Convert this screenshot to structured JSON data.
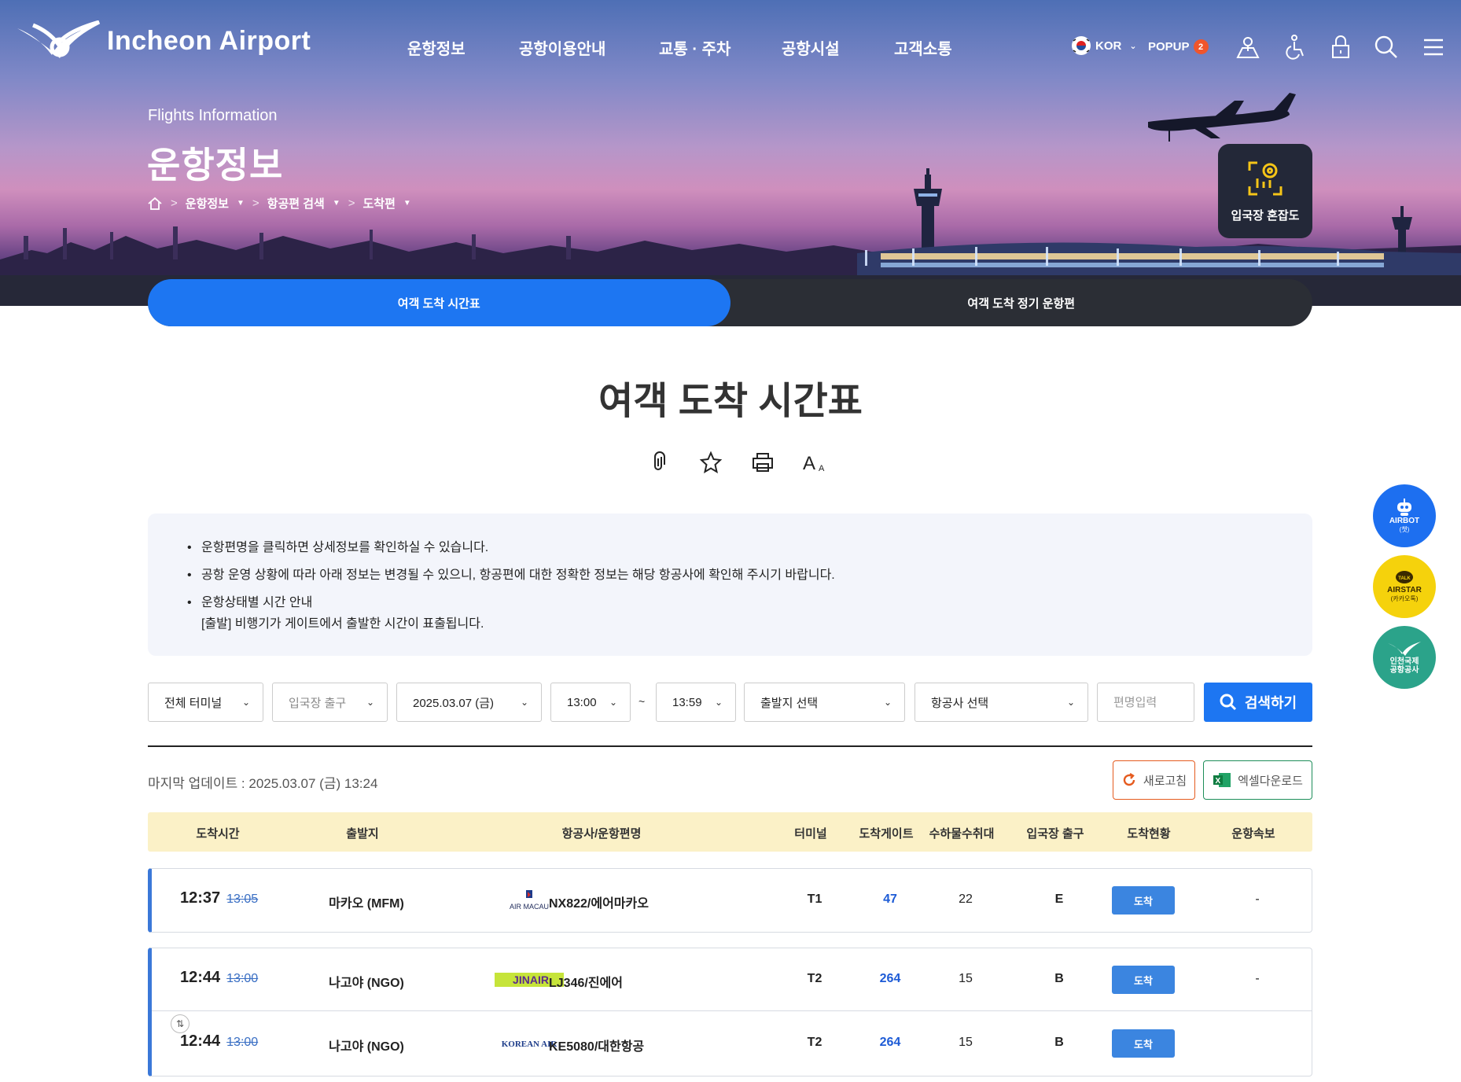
{
  "header": {
    "logo_text": "Incheon Airport",
    "menu": [
      "운항정보",
      "공항이용안내",
      "교통 · 주차",
      "공항시설",
      "고객소통"
    ],
    "lang": "KOR",
    "popup_label": "POPUP",
    "popup_count": "2",
    "icons": [
      "map-pin-icon",
      "wheelchair-icon",
      "lock-icon",
      "search-icon",
      "hamburger-menu-icon"
    ]
  },
  "hero": {
    "subtitle": "Flights Information",
    "title": "운항정보",
    "breadcrumb": [
      "운항정보",
      "항공편 검색",
      "도착편"
    ],
    "congestion_label": "입국장 혼잡도"
  },
  "tabs": [
    {
      "label": "여객 도착 시간표",
      "active": true
    },
    {
      "label": "여객 도착 정기 운항편",
      "active": false
    }
  ],
  "page_title": "여객 도착 시간표",
  "tools": [
    "clip-icon",
    "star-icon",
    "print-icon",
    "font-size-icon"
  ],
  "notice": {
    "items": [
      "운항편명을 클릭하면 상세정보를 확인하실 수 있습니다.",
      "공항 운영 상황에 따라 아래 정보는 변경될 수 있으니, 항공편에 대한 정확한 정보는 해당 항공사에 확인해 주시기 바랍니다.",
      "운항상태별 시간 안내"
    ],
    "sub_item": "[출발] 비행기가 게이트에서 출발한 시간이 표출됩니다."
  },
  "filters": {
    "terminal": "전체 터미널",
    "exit_placeholder": "입국장 출구",
    "date": "2025.03.07 (금)",
    "time_from": "13:00",
    "tilde": "~",
    "time_to": "13:59",
    "origin": "출발지 선택",
    "airline": "항공사 선택",
    "flight_placeholder": "편명입력",
    "search_label": "검색하기"
  },
  "last_update": "마지막 업데이트 : 2025.03.07 (금) 13:24",
  "buttons": {
    "refresh": "새로고침",
    "excel": "엑셀다운로드"
  },
  "table": {
    "headers": [
      "도착시간",
      "출발지",
      "항공사/운항편명",
      "터미널",
      "도착게이트",
      "수하물수취대",
      "입국장 출구",
      "도착현황",
      "운항속보"
    ],
    "rows": [
      {
        "time": "12:37",
        "scheduled": "13:05",
        "origin": "마카오 (MFM)",
        "airline_logo": "AIR MACAU",
        "flight": "NX822/에어마카오",
        "terminal": "T1",
        "gate": "47",
        "carousel": "22",
        "exit": "E",
        "status": "도착",
        "news": "-"
      },
      {
        "time": "12:44",
        "scheduled": "13:00",
        "origin": "나고야 (NGO)",
        "airline_logo": "JINAIR",
        "flight": "LJ346/진에어",
        "terminal": "T2",
        "gate": "264",
        "carousel": "15",
        "exit": "B",
        "status": "도착",
        "news": "-"
      },
      {
        "time": "12:44",
        "scheduled": "13:00",
        "origin": "나고야 (NGO)",
        "airline_logo": "KOREAN AIR",
        "flight": "KE5080/대한항공",
        "terminal": "T2",
        "gate": "264",
        "carousel": "15",
        "exit": "B",
        "status": "도착",
        "news": ""
      }
    ]
  },
  "floating": {
    "airbot": {
      "label": "AIRBOT",
      "sub": "(챗)",
      "color": "#1d6ff0"
    },
    "airstar": {
      "label": "AIRSTAR",
      "sub": "(카카오톡)",
      "tag": "TALK",
      "color": "#f5d20c"
    },
    "iiac": {
      "label": "인천국제",
      "label2": "공항공사",
      "color": "#2ba38a"
    }
  },
  "colors": {
    "accent": "#1d76f2",
    "tab_bg": "#2b2e35",
    "header_row": "#fbf1c7",
    "status": "#3b85e0",
    "gate_text": "#1d5bd6"
  }
}
